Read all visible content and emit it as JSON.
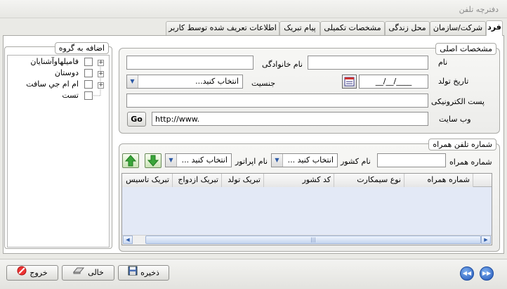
{
  "window": {
    "title": "دفترچه تلفن"
  },
  "tabs": [
    {
      "label": "فرد",
      "active": true
    },
    {
      "label": "شرکت/سازمان"
    },
    {
      "label": "محل زندگی"
    },
    {
      "label": "مشخصات تکمیلی"
    },
    {
      "label": "پیام تبریک"
    },
    {
      "label": "اطلاعات تعریف شده توسط کاربر"
    }
  ],
  "main_info": {
    "title": "مشخصات اصلی",
    "name_label": "نام",
    "family_label": "نام خانوادگی",
    "birth_label": "تاریخ تولد",
    "birth_value": "__/__/____",
    "gender_label": "جنسیت",
    "gender_value": "انتخاب کنید...",
    "email_label": "پست الکترونیکی",
    "website_label": "وب سایت",
    "website_value": "http://www.",
    "go_label": "Go"
  },
  "group_panel": {
    "title": "اضافه به گروه",
    "items": [
      {
        "label": "فامیلها‌وآشنایان",
        "expandable": true
      },
      {
        "label": "دوستان",
        "expandable": true
      },
      {
        "label": "ام ام جي سافت",
        "expandable": true
      },
      {
        "label": "تست",
        "expandable": false
      }
    ]
  },
  "phone": {
    "title": "شماره تلفن همراه",
    "mobile_label": "شماره همراه",
    "country_label": "نام کشور",
    "country_value": "انتخاب کنید ...",
    "operator_label": "نام اپراتور",
    "operator_value": "انتخاب کنید ...",
    "columns": [
      "شماره همراه",
      "نوع سیمکارت",
      "کد کشور",
      "تبریک تولد",
      "تبریک ازدواج",
      "تبریک تاسیس"
    ]
  },
  "footer": {
    "exit": "خروج",
    "clear": "خالی",
    "save": "ذخیره"
  },
  "colors": {
    "accent": "#1f55b8",
    "grid_bg": "#e3e9f6"
  }
}
